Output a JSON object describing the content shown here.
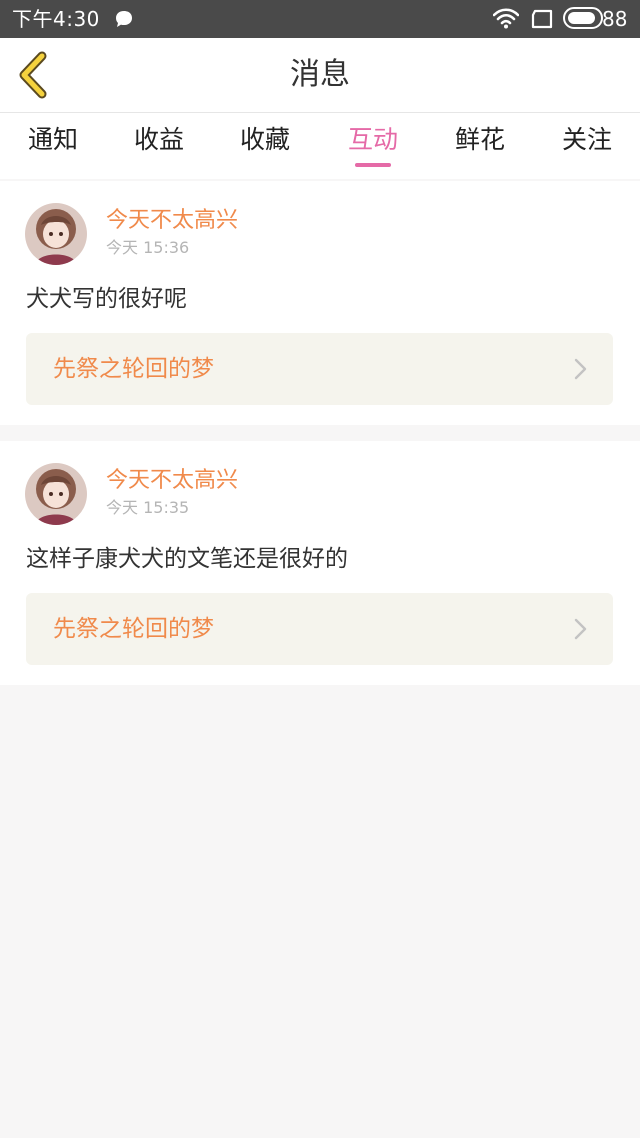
{
  "status_bar": {
    "time": "下午4:30",
    "battery": "88"
  },
  "header": {
    "title": "消息"
  },
  "tabs": [
    {
      "label": "通知"
    },
    {
      "label": "收益"
    },
    {
      "label": "收藏"
    },
    {
      "label": "互动"
    },
    {
      "label": "鲜花"
    },
    {
      "label": "关注"
    }
  ],
  "active_tab": "互动",
  "messages": [
    {
      "user": "今天不太高兴",
      "day": "今天",
      "clock": "15:36",
      "content": "犬犬写的很好呢",
      "ref_title": "先祭之轮回的梦"
    },
    {
      "user": "今天不太高兴",
      "day": "今天",
      "clock": "15:35",
      "content": "这样子康犬犬的文笔还是很好的",
      "ref_title": "先祭之轮回的梦"
    }
  ],
  "colors": {
    "accent_pink": "#e56aa7",
    "name_orange": "#f08a4b",
    "status_bar": "#4a4a4a",
    "back_arrow": "#f5d23e"
  }
}
